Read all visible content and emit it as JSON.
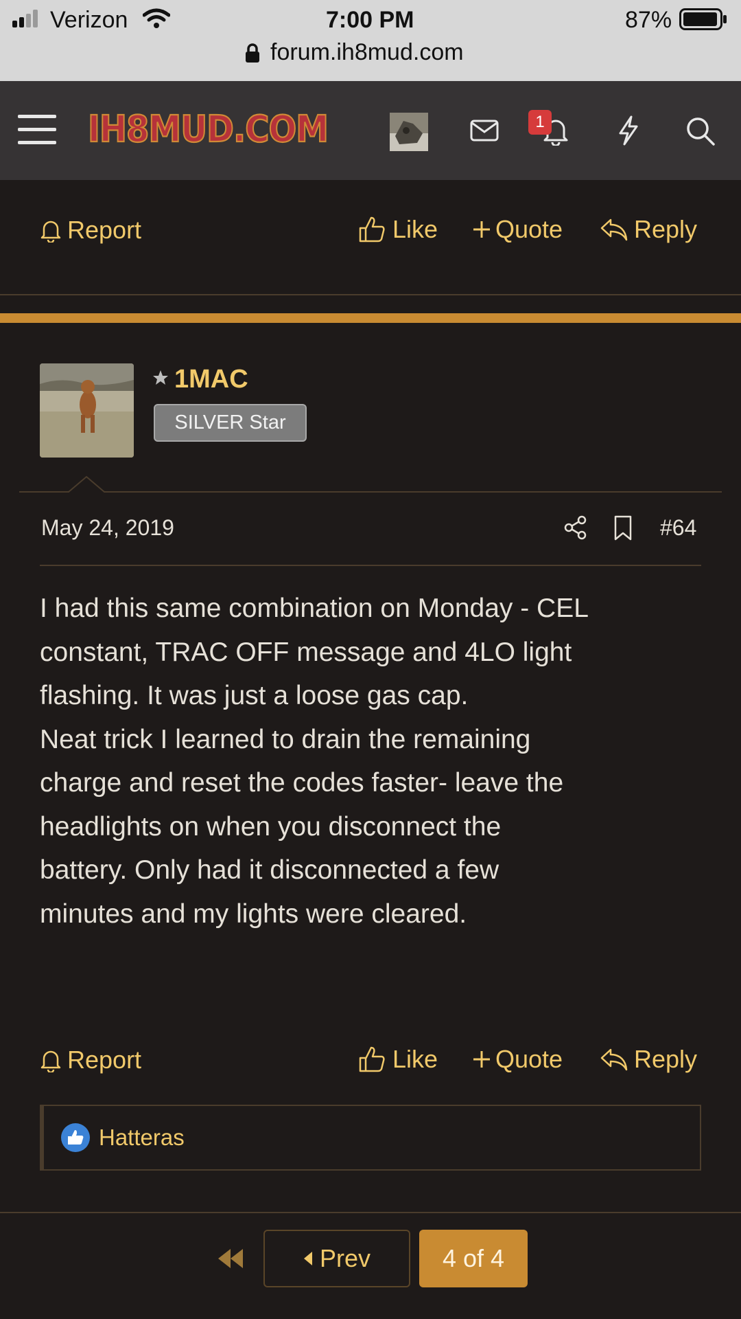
{
  "status_bar": {
    "carrier": "Verizon",
    "time": "7:00 PM",
    "battery": "87%",
    "url": "forum.ih8mud.com"
  },
  "header": {
    "logo_text": "IH8MUD.COM",
    "notification_count": "1"
  },
  "top_actions": {
    "report": "Report",
    "like": "Like",
    "quote": "Quote",
    "reply": "Reply"
  },
  "post": {
    "username": "1MAC",
    "user_title": "SILVER Star",
    "date": "May 24, 2019",
    "post_number": "#64",
    "body_lines": [
      "I had this same combination on Monday - CEL",
      "constant, TRAC OFF message and 4LO light",
      "flashing. It was just a loose gas cap.",
      "Neat trick I learned to drain the remaining",
      "charge and reset the codes faster- leave the",
      "headlights on when you disconnect the",
      "battery. Only had it disconnected a few",
      "minutes and my lights were cleared."
    ],
    "actions": {
      "report": "Report",
      "like": "Like",
      "quote": "Quote",
      "reply": "Reply"
    },
    "reactions": {
      "liked_by": "Hatteras"
    }
  },
  "pagination": {
    "prev": "Prev",
    "current": "4 of 4"
  },
  "colors": {
    "background": "#1e1a19",
    "header": "#363334",
    "accent": "#c98b32",
    "link": "#f1c96a"
  }
}
